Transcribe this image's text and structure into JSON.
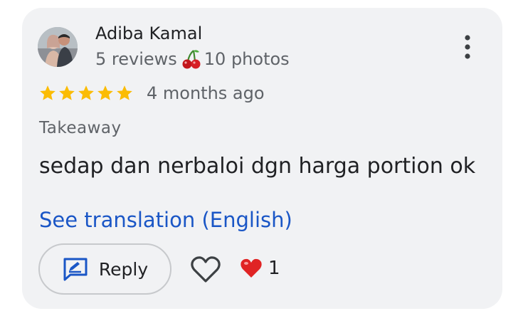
{
  "review": {
    "author_name": "Adiba Kamal",
    "reviews_count": "5 reviews",
    "photos_count": "10 photos",
    "badge_icon": "cherry-icon",
    "rating": 5,
    "rating_max": 5,
    "time_ago": "4 months ago",
    "service_type": "Takeaway",
    "text": "sedap dan nerbaloi dgn harga portion ok",
    "translate_link": "See translation (English)"
  },
  "actions": {
    "reply_label": "Reply",
    "reaction_count": "1"
  },
  "colors": {
    "card_bg": "#f1f2f4",
    "star": "#fbbc04",
    "link": "#1a56c6",
    "heart": "#e02424"
  }
}
